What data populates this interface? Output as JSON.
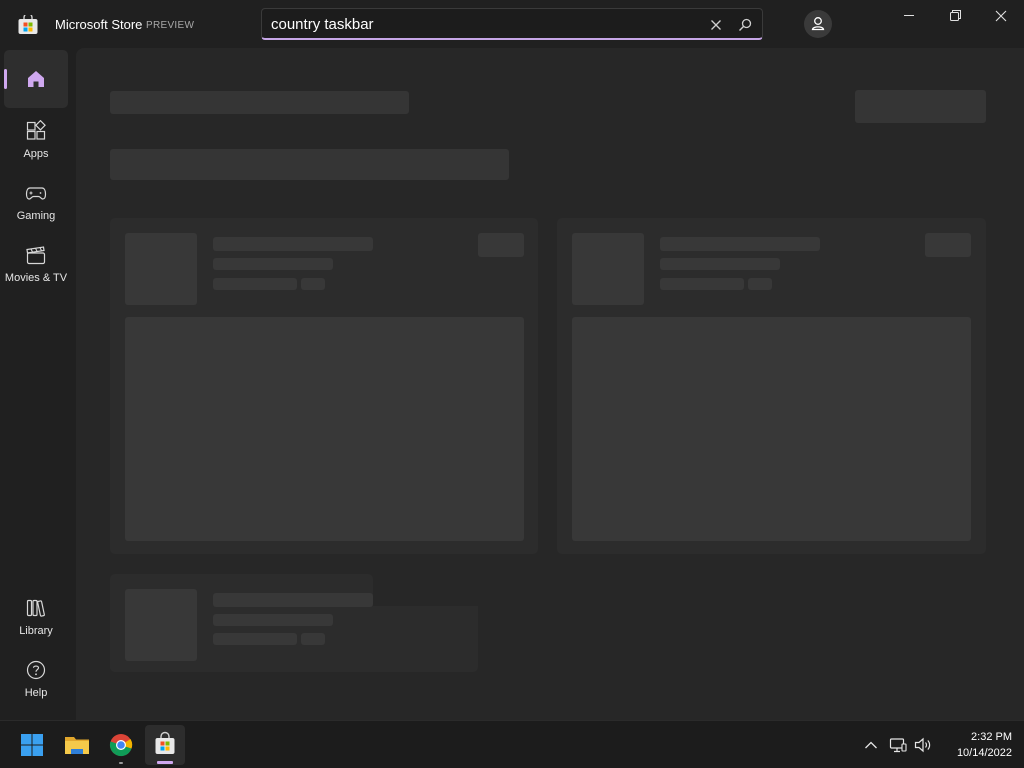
{
  "titlebar": {
    "app_title": "Microsoft Store",
    "badge": "PREVIEW",
    "search": {
      "value": "country taskbar"
    },
    "icons": {
      "logo": "store-logo-icon",
      "clear": "close-icon",
      "search": "search-icon",
      "account": "person-icon",
      "minimize": "minimize-icon",
      "restore": "restore-icon",
      "close": "close-icon"
    }
  },
  "nav": {
    "items": [
      {
        "label": "",
        "icon": "home-icon",
        "active": true
      },
      {
        "label": "Apps",
        "icon": "apps-icon"
      },
      {
        "label": "Gaming",
        "icon": "gamepad-icon"
      },
      {
        "label": "Movies & TV",
        "icon": "clapperboard-icon"
      },
      {
        "label": "Library",
        "icon": "library-icon"
      },
      {
        "label": "Help",
        "icon": "help-icon"
      }
    ]
  },
  "taskbar": {
    "apps": [
      {
        "name": "Start",
        "icon": "windows-start-icon"
      },
      {
        "name": "File Explorer",
        "icon": "folder-icon"
      },
      {
        "name": "Google Chrome",
        "icon": "chrome-icon"
      },
      {
        "name": "Microsoft Store",
        "icon": "store-icon",
        "active": true
      }
    ],
    "tray": {
      "chevron": "chevron-up-icon",
      "network": "network-icon",
      "volume": "volume-icon"
    },
    "time": "2:32 PM",
    "date": "10/14/2022"
  },
  "colors": {
    "accent": "#cfa8ef",
    "background": "#202020",
    "content": "#272727",
    "skeleton": "#353535"
  }
}
